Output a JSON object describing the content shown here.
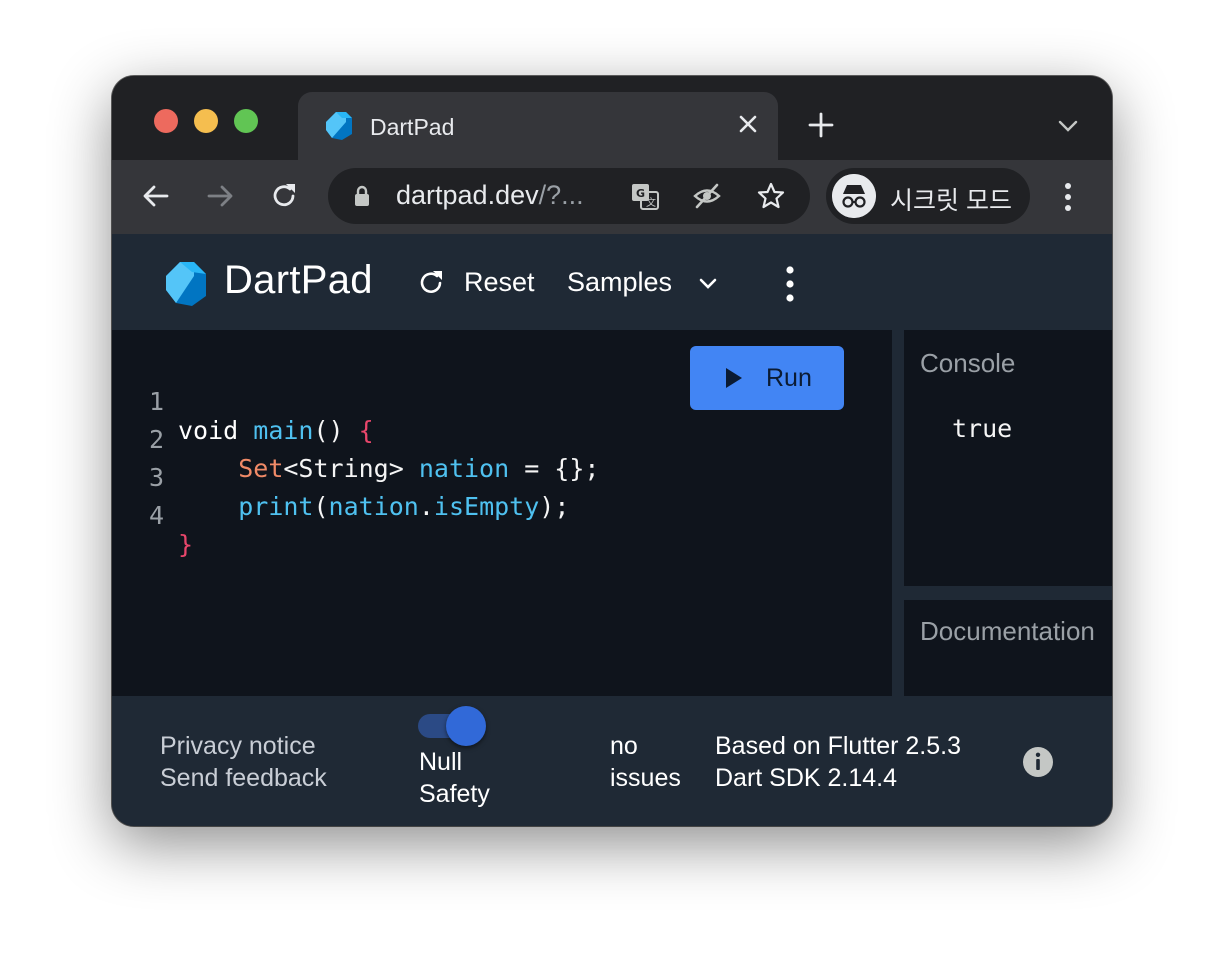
{
  "browser": {
    "tab": {
      "title": "DartPad",
      "icon": "dart-logo-icon"
    },
    "toolbar": {
      "url_host": "dartpad.dev",
      "url_rest": "/?...",
      "incognito_label": "시크릿 모드"
    }
  },
  "dartpad": {
    "title": "DartPad",
    "reset_label": "Reset",
    "samples_label": "Samples",
    "run_label": "Run",
    "code": {
      "line_numbers": [
        "1",
        "2",
        "3",
        "4"
      ],
      "line1": {
        "def": "void ",
        "fn": "main",
        "rest": "() ",
        "brace": "{"
      },
      "line2": {
        "indent": "    ",
        "type": "Set",
        "generic": "<String> ",
        "ident": "nation",
        "rest": " = {};"
      },
      "line3": {
        "indent": "    ",
        "fn": "print",
        "open": "(",
        "obj": "nation",
        "dot": ".",
        "prop": "isEmpty",
        "close": ");"
      },
      "line4": {
        "brace": "}"
      }
    },
    "console": {
      "title": "Console",
      "output": "true"
    },
    "documentation": {
      "title": "Documentation"
    },
    "footer": {
      "privacy_notice": "Privacy notice",
      "send_feedback": "Send feedback",
      "null_safety_line1": "Null",
      "null_safety_line2": "Safety",
      "null_safety_enabled": true,
      "issues_line1": "no",
      "issues_line2": "issues",
      "flutter_version": "Based on Flutter 2.5.3",
      "dart_sdk": "Dart SDK 2.14.4"
    }
  },
  "colors": {
    "accent": "#4285f4",
    "header_bg": "#1f2935",
    "editor_bg": "#0f141c"
  }
}
